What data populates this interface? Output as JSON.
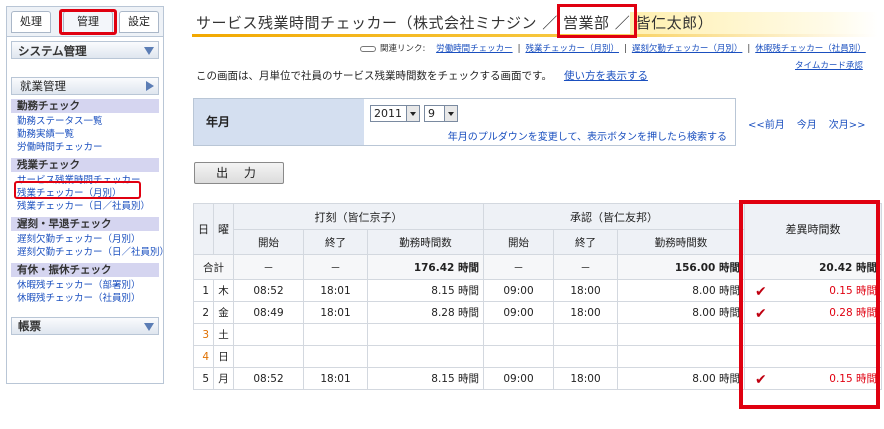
{
  "sidebar": {
    "tabs": [
      "処理",
      "管理",
      "設定"
    ],
    "system_header": "システム管理",
    "work_header": "就業管理",
    "groups": [
      {
        "title": "勤務チェック",
        "links": [
          "勤務ステータス一覧",
          "勤務実績一覧",
          "労働時間チェッカー"
        ]
      },
      {
        "title": "残業チェック",
        "links": [
          "サービス残業時間チェッカー",
          "残業チェッカー（月別）",
          "残業チェッカー（日／社員別）"
        ]
      },
      {
        "title": "遅刻・早退チェック",
        "links": [
          "遅刻欠勤チェッカー（月別）",
          "遅刻欠勤チェッカー（日／社員別）"
        ]
      },
      {
        "title": "有休・振休チェック",
        "links": [
          "休暇残チェッカー（部署別）",
          "休暇残チェッカー（社員別）"
        ]
      }
    ],
    "ledger_header": "帳票"
  },
  "page": {
    "title": "サービス残業時間チェッカー（株式会社ミナジン ／ 営業部 ／ 皆仁太郎）",
    "related_label": "関連リンク:",
    "related_links": [
      "労働時間チェッカー",
      "残業チェッカー（月別）",
      "遅刻欠勤チェッカー（月別）",
      "休暇残チェッカー（社員別）"
    ],
    "timecard_link": "タイムカード承認",
    "description": "この画面は、月単位で社員のサービス残業時間数をチェックする画面です。",
    "howto_link": "使い方を表示する"
  },
  "filter": {
    "label": "年月",
    "year": "2011",
    "month": "9",
    "hint": "年月のプルダウンを変更して、表示ボタンを押したら検索する",
    "prev": "<<前月",
    "current": "今月",
    "next": "次月>>"
  },
  "output_button": "出 力",
  "table": {
    "h_day": "日",
    "h_weekday": "曜",
    "h_stamp": "打刻（皆仁京子）",
    "h_approve": "承認（皆仁友邦）",
    "h_diff": "差異時間数",
    "h_start": "開始",
    "h_end": "終了",
    "h_work": "勤務時間数",
    "sum": {
      "label": "合計",
      "s_start": "－",
      "s_end": "－",
      "s_work": "176.42 時間",
      "a_start": "－",
      "a_end": "－",
      "a_work": "156.00 時間",
      "diff": "20.42 時間"
    },
    "rows": [
      {
        "day": "1",
        "wd": "木",
        "s_start": "08:52",
        "s_end": "18:01",
        "s_work": "8.15 時間",
        "a_start": "09:00",
        "a_end": "18:00",
        "a_work": "8.00 時間",
        "diff": "0.15 時間",
        "flag": true
      },
      {
        "day": "2",
        "wd": "金",
        "s_start": "08:49",
        "s_end": "18:01",
        "s_work": "8.28 時間",
        "a_start": "09:00",
        "a_end": "18:00",
        "a_work": "8.00 時間",
        "diff": "0.28 時間",
        "flag": true
      },
      {
        "day": "3",
        "wd": "土",
        "s_start": "",
        "s_end": "",
        "s_work": "",
        "a_start": "",
        "a_end": "",
        "a_work": "",
        "diff": "",
        "flag": false
      },
      {
        "day": "4",
        "wd": "日",
        "s_start": "",
        "s_end": "",
        "s_work": "",
        "a_start": "",
        "a_end": "",
        "a_work": "",
        "diff": "",
        "flag": false
      },
      {
        "day": "5",
        "wd": "月",
        "s_start": "08:52",
        "s_end": "18:01",
        "s_work": "8.15 時間",
        "a_start": "09:00",
        "a_end": "18:00",
        "a_work": "8.00 時間",
        "diff": "0.15 時間",
        "flag": true
      }
    ]
  },
  "colors": {
    "highlight_red": "#e00010",
    "link_blue": "#1a4fbf",
    "menu_group_bg": "#d5d5f0",
    "title_accent": "#f2a800"
  }
}
